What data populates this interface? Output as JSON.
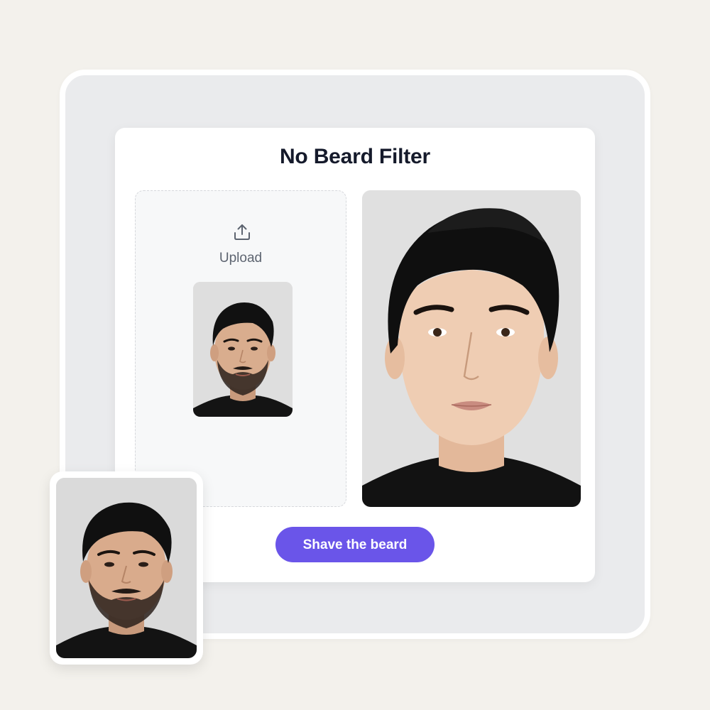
{
  "panel": {
    "title": "No Beard Filter"
  },
  "upload": {
    "label": "Upload",
    "icon": "upload-icon"
  },
  "action": {
    "button_label": "Shave the beard"
  },
  "colors": {
    "background": "#f3f1ec",
    "frame": "#eaebed",
    "panel": "#ffffff",
    "title": "#151a2b",
    "accent": "#6a55e9",
    "muted_text": "#5d6470"
  },
  "images": {
    "upload_preview": "bearded-man-portrait",
    "result": "clean-shaven-man-portrait",
    "source_card": "bearded-man-portrait"
  }
}
